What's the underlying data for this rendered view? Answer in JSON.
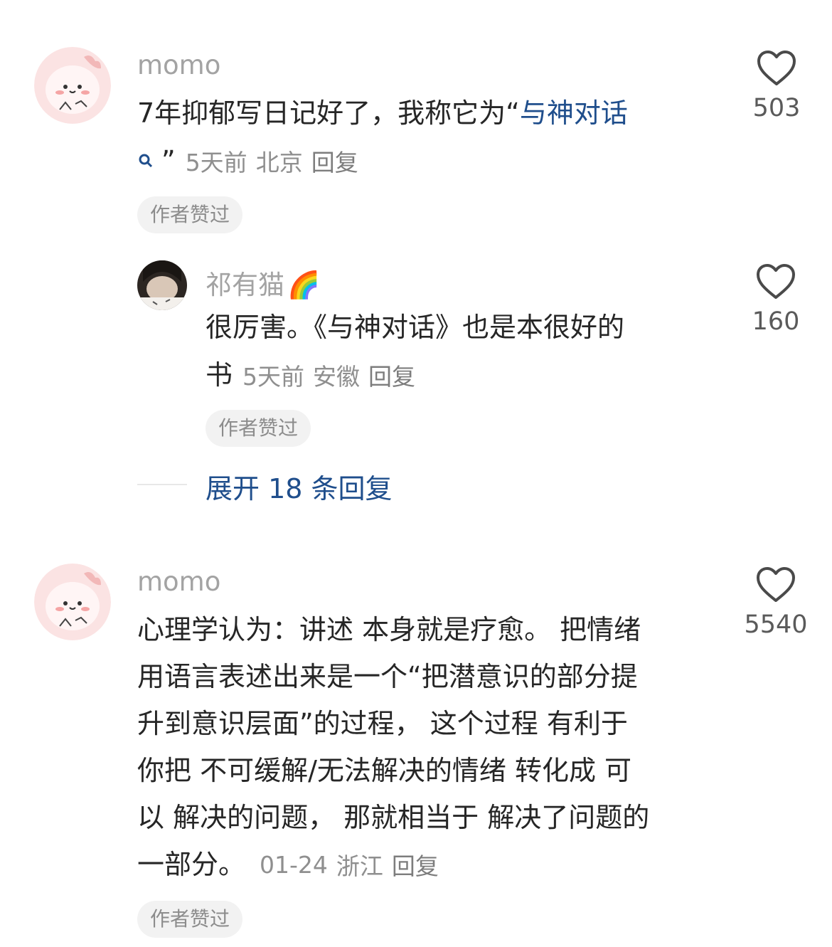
{
  "comments": [
    {
      "user": "momo",
      "text_main": "7年抑郁写日记好了，我称它为“",
      "link": "与神对话",
      "text_after": "”",
      "time": "5天前",
      "location": "北京",
      "reply_label": "回复",
      "badge": "作者赞过",
      "likes": "503",
      "replies": [
        {
          "user": "祁有猫",
          "emoji": "🌈",
          "text_line1": "很厉害。《与神对话》也是本很好的",
          "text_line2": "书",
          "time": "5天前",
          "location": "安徽",
          "reply_label": "回复",
          "badge": "作者赞过",
          "likes": "160"
        }
      ],
      "expand_label": "展开 18 条回复"
    },
    {
      "user": "momo",
      "lines": [
        "心理学认为：讲述 本身就是疗愈。 把情绪",
        "用语言表述出来是一个“把潜意识的部分提",
        "升到意识层面”的过程， 这个过程 有利于",
        "你把 不可缓解/无法解决的情绪 转化成 可",
        "以 解决的问题， 那就相当于 解决了问题的",
        "一部分。"
      ],
      "time": "01-24",
      "location": "浙江",
      "reply_label": "回复",
      "badge": "作者赞过",
      "likes": "5540"
    }
  ],
  "icons": {
    "heart": "heart-icon",
    "search": "search-icon"
  }
}
